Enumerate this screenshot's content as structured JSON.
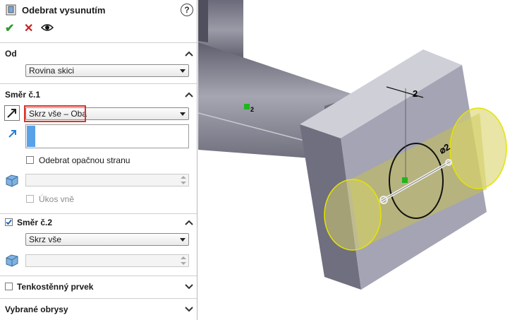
{
  "feature": {
    "title": "Odebrat vysunutím",
    "help": "?"
  },
  "actions": {
    "ok": "✔",
    "cancel": "✕",
    "preview": "👁"
  },
  "od": {
    "header": "Od",
    "select_value": "Rovina skici"
  },
  "smer1": {
    "header": "Směr č.1",
    "select_value": "Skrz vše – Oba",
    "checkbox_opposite": "Odebrat opačnou stranu",
    "checkbox_draft": "Úkos vně"
  },
  "smer2": {
    "header": "Směr č.2",
    "checked": true,
    "select_value": "Skrz vše"
  },
  "thin": {
    "header": "Tenkostěnný prvek"
  },
  "contours": {
    "header": "Vybrané obrysy"
  },
  "viewport": {
    "dim_top": "2",
    "dim_diameter": "⌀2",
    "marker_label": "2"
  },
  "colors": {
    "accent_red": "#d9342b",
    "selection_blue": "#5aa2e8",
    "preview_yellow": "#e5e400"
  }
}
